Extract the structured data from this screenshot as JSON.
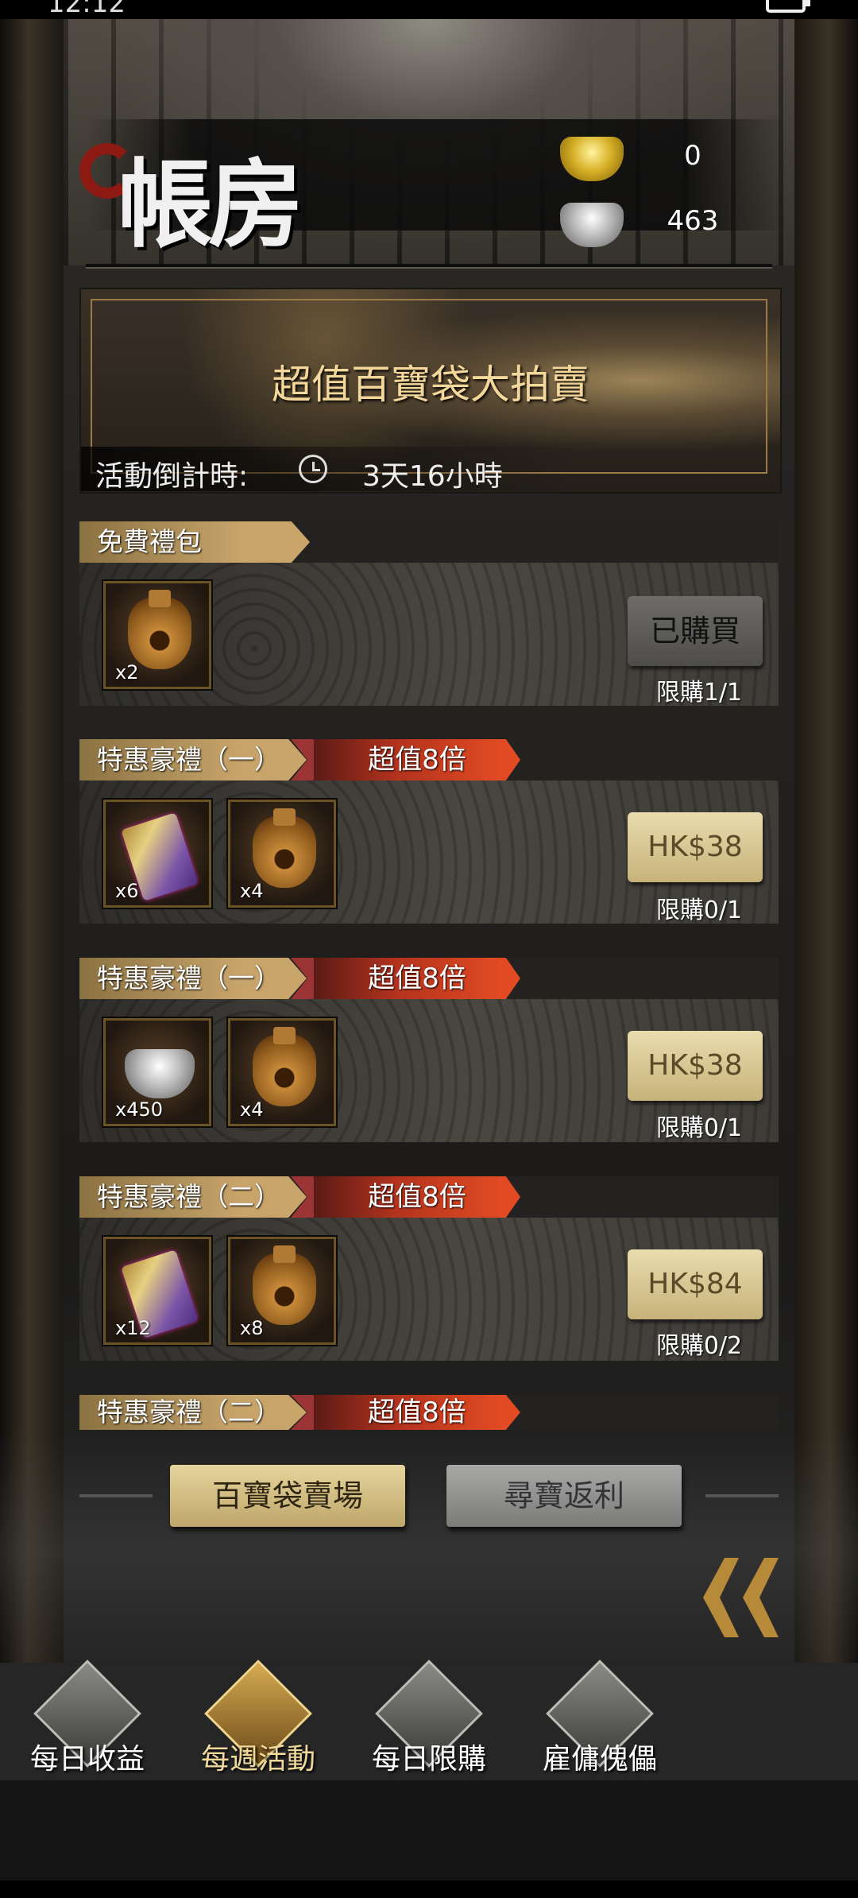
{
  "status_bar": {
    "time": "12:12"
  },
  "header": {
    "title": "帳房",
    "gold_amount": "0",
    "silver_amount": "463"
  },
  "banner": {
    "title": "超值百寶袋大拍賣",
    "countdown_label": "活動倒計時:",
    "countdown_value": "3天16小時"
  },
  "gifts": [
    {
      "label": "免費禮包",
      "promo": "",
      "items": [
        {
          "icon": "fortune-bag-icon",
          "count": "x2"
        }
      ],
      "button": "已購買",
      "limit": "限購1/1"
    },
    {
      "label": "特惠豪禮（一）",
      "promo": "超值8倍",
      "items": [
        {
          "icon": "card-icon",
          "count": "x6"
        },
        {
          "icon": "fortune-bag-icon",
          "count": "x4"
        }
      ],
      "button": "HK$38",
      "limit": "限購0/1"
    },
    {
      "label": "特惠豪禮（一）",
      "promo": "超值8倍",
      "items": [
        {
          "icon": "silver-ingot-icon",
          "count": "x450"
        },
        {
          "icon": "fortune-bag-icon",
          "count": "x4"
        }
      ],
      "button": "HK$38",
      "limit": "限購0/1"
    },
    {
      "label": "特惠豪禮（二）",
      "promo": "超值8倍",
      "items": [
        {
          "icon": "card-icon",
          "count": "x12"
        },
        {
          "icon": "fortune-bag-icon",
          "count": "x8"
        }
      ],
      "button": "HK$84",
      "limit": "限購0/2"
    },
    {
      "label": "特惠豪禮（二）",
      "promo": "超值8倍"
    }
  ],
  "footer_tabs": {
    "market": "百寶袋賣場",
    "rebate": "尋寶返利"
  },
  "bottom_nav": [
    {
      "label": "每日收益",
      "icon": "coins-icon"
    },
    {
      "label": "每週活動",
      "icon": "weekly-event-icon",
      "active": true
    },
    {
      "label": "每日限購",
      "icon": "treasure-chest-icon"
    },
    {
      "label": "雇傭傀儡",
      "icon": "puppet-icon"
    }
  ]
}
